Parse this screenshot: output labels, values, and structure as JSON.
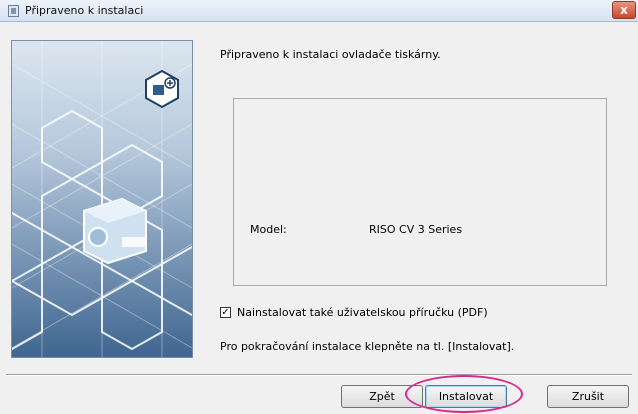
{
  "window": {
    "title": "Připraveno k instalaci",
    "close_label": "x"
  },
  "heading": "Připraveno k instalaci ovladače tiskárny.",
  "info": {
    "model_label": "Model:",
    "model_value": "RISO CV 3 Series"
  },
  "option": {
    "label": "Nainstalovat také uživatelskou příručku (PDF)",
    "checked": true,
    "check_mark": "✓"
  },
  "hint": "Pro pokračování instalace klepněte na tl. [Instalovat].",
  "buttons": {
    "back": "Zpět",
    "install": "Instalovat",
    "cancel": "Zrušit"
  },
  "colors": {
    "highlight": "#d62a8c",
    "banner_blue": "#4a6e98"
  }
}
